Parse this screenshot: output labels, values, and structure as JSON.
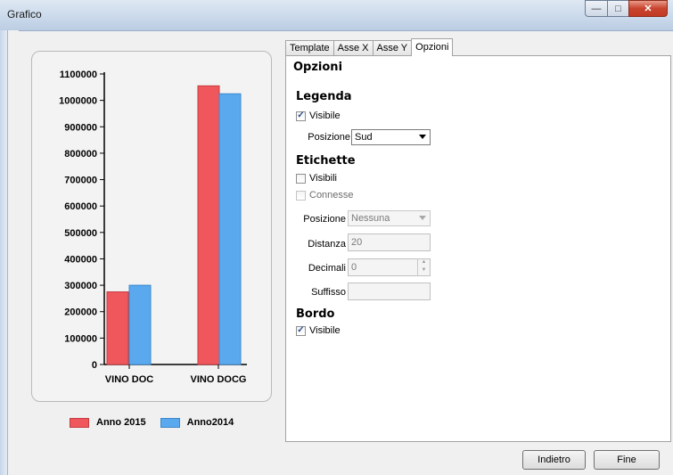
{
  "window": {
    "title": "Grafico"
  },
  "tabs": [
    "Template",
    "Asse X",
    "Asse Y",
    "Opzioni"
  ],
  "panel": {
    "title": "Opzioni",
    "legenda": {
      "heading": "Legenda",
      "visibile_label": "Visibile",
      "visibile_checked": true,
      "posizione_label": "Posizione",
      "posizione_value": "Sud"
    },
    "etichette": {
      "heading": "Etichette",
      "visibili_label": "Visibili",
      "connesse_label": "Connesse",
      "posizione_label": "Posizione",
      "posizione_value": "Nessuna",
      "distanza_label": "Distanza",
      "distanza_value": "20",
      "decimali_label": "Decimali",
      "decimali_value": "0",
      "suffisso_label": "Suffisso",
      "suffisso_value": ""
    },
    "bordo": {
      "heading": "Bordo",
      "visibile_label": "Visibile",
      "visibile_checked": true
    }
  },
  "buttons": {
    "back": "Indietro",
    "finish": "Fine"
  },
  "chart_data": {
    "type": "bar",
    "categories": [
      "VINO DOC",
      "VINO DOCG"
    ],
    "series": [
      {
        "name": "Anno 2015",
        "values": [
          275000,
          1055000
        ],
        "color": "#f0575c"
      },
      {
        "name": "Anno2014",
        "values": [
          300000,
          1025000
        ],
        "color": "#5aa9ef"
      }
    ],
    "yticks": [
      "0",
      "100000",
      "200000",
      "300000",
      "400000",
      "500000",
      "600000",
      "700000",
      "800000",
      "900000",
      "1000000",
      "1100000"
    ],
    "ylim": [
      0,
      1100000
    ],
    "legend": "bottom"
  }
}
